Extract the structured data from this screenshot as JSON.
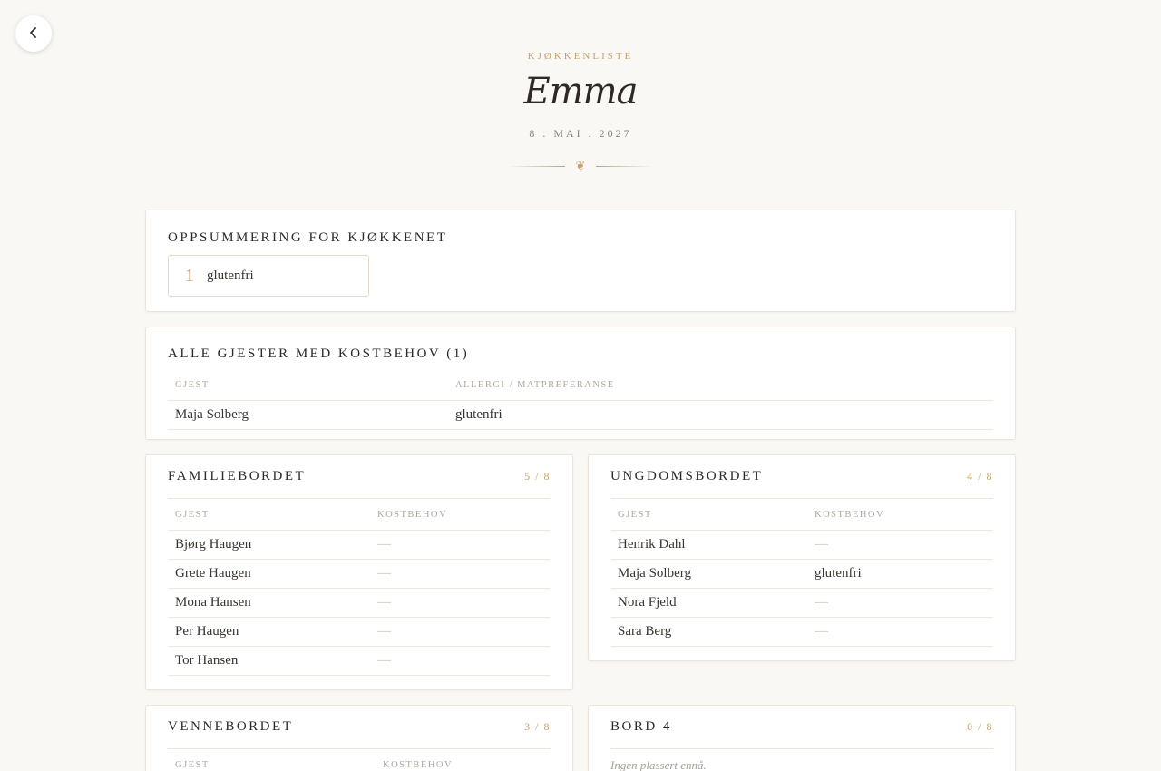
{
  "header": {
    "eyebrow": "KJØKKENLISTE",
    "name": "Emma",
    "date": "8 . MAI . 2027",
    "ornament": "❦"
  },
  "summary": {
    "title": "OPPSUMMERING FOR KJØKKENET",
    "items": [
      {
        "count": "1",
        "label": "glutenfri"
      }
    ]
  },
  "all_guests": {
    "title": "ALLE GJESTER MED KOSTBEHOV (1)",
    "col_guest": "GJEST",
    "col_pref": "ALLERGI / MATPREFERANSE",
    "rows": [
      {
        "guest": "Maja Solberg",
        "pref": "glutenfri"
      }
    ]
  },
  "tables": [
    {
      "title": "FAMILIEBORDET",
      "count": "5 / 8",
      "col_guest": "GJEST",
      "col_diet": "KOSTBEHOV",
      "rows": [
        {
          "guest": "Bjørg Haugen",
          "diet": "—"
        },
        {
          "guest": "Grete Haugen",
          "diet": "—"
        },
        {
          "guest": "Mona Hansen",
          "diet": "—"
        },
        {
          "guest": "Per Haugen",
          "diet": "—"
        },
        {
          "guest": "Tor Hansen",
          "diet": "—"
        }
      ]
    },
    {
      "title": "UNGDOMSBORDET",
      "count": "4 / 8",
      "col_guest": "GJEST",
      "col_diet": "KOSTBEHOV",
      "rows": [
        {
          "guest": "Henrik Dahl",
          "diet": "—"
        },
        {
          "guest": "Maja Solberg",
          "diet": "glutenfri"
        },
        {
          "guest": "Nora Fjeld",
          "diet": "—"
        },
        {
          "guest": "Sara Berg",
          "diet": "—"
        }
      ]
    },
    {
      "title": "VENNEBORDET",
      "count": "3 / 8",
      "col_guest": "GJEST",
      "col_diet": "KOSTBEHOV",
      "rows": []
    },
    {
      "title": "BORD 4",
      "count": "0 / 8",
      "empty": "Ingen plassert ennå."
    }
  ]
}
